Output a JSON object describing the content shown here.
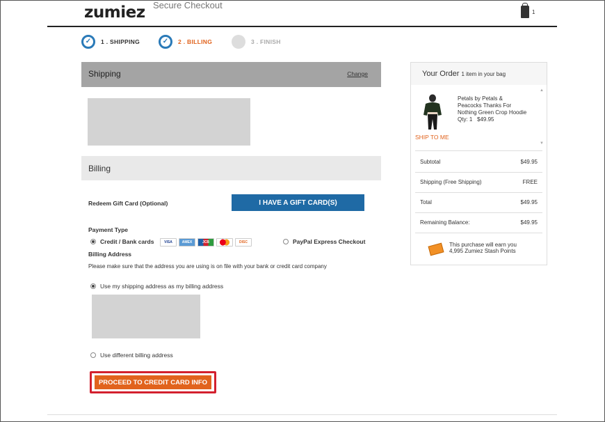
{
  "header": {
    "logo": "zumiez",
    "secure_checkout": "Secure Checkout",
    "bag_count": "1"
  },
  "steps": [
    {
      "label": "1 . SHIPPING",
      "state": "done"
    },
    {
      "label": "2 . BILLING",
      "state": "active"
    },
    {
      "label": "3 . FINISH",
      "state": "pending"
    }
  ],
  "shipping": {
    "title": "Shipping",
    "change": "Change"
  },
  "billing": {
    "title": "Billing",
    "redeem_label": "Redeem Gift Card (Optional)",
    "gift_button": "I HAVE A GIFT CARD(S)",
    "payment_type": "Payment Type",
    "credit_option": "Credit / Bank cards",
    "card_logos": [
      "VISA",
      "AMEX",
      "JCB",
      "MC",
      "DISC"
    ],
    "paypal_option": "PayPal Express Checkout",
    "billing_address": "Billing Address",
    "note": "Please make sure that the address you are using is on file with your bank or credit card company",
    "use_shipping": "Use my shipping address as my billing address",
    "use_different": "Use different billing address",
    "proceed_button": "PROCEED TO CREDIT CARD INFO"
  },
  "order": {
    "title": "Your Order",
    "subtitle": "1 item in your bag",
    "product_name": "Petals by Petals & Peacocks Thanks For Nothing Green Crop Hoodie",
    "qty": "Qty: 1",
    "price": "$49.95",
    "ship_to_me": "SHIP TO ME",
    "summary": [
      {
        "label": "Subtotal",
        "value": "$49.95"
      },
      {
        "label": "Shipping (Free Shipping)",
        "value": "FREE"
      },
      {
        "label": "Total",
        "value": "$49.95"
      },
      {
        "label": "Remaining Balance:",
        "value": "$49.95"
      }
    ],
    "stash_line1": "This purchase will earn you",
    "stash_line2": "4,995 Zumiez Stash Points"
  },
  "colors": {
    "accent_orange": "#e1631d",
    "button_blue": "#1f6aa5",
    "step_blue": "#2a7ab8",
    "highlight_red": "#d3202e"
  }
}
